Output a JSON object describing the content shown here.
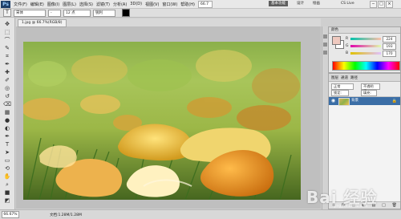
{
  "app": {
    "logo_text": "Ps",
    "menu": [
      "文件(F)",
      "编辑(E)",
      "图像(I)",
      "图层(L)",
      "选择(S)",
      "滤镜(T)",
      "分析(A)",
      "3D(D)",
      "视图(V)",
      "窗口(W)",
      "帮助(H)"
    ],
    "zoom_field": "66.7",
    "workspace_active": "基本功能",
    "workspace_links": [
      "设计",
      "绘画"
    ],
    "cs_live": "CS Live"
  },
  "options": {
    "font_family": "宋体",
    "font_style": "-",
    "font_size": "12 点",
    "anti_alias": "锐利",
    "color_hex": "#000000"
  },
  "document": {
    "tab_label": "1.jpg @ 66.7%(RGB/8)"
  },
  "tools": [
    {
      "name": "move-tool-icon",
      "symbol": "✥"
    },
    {
      "name": "marquee-tool-icon",
      "symbol": "⬚"
    },
    {
      "name": "lasso-tool-icon",
      "symbol": "⌒"
    },
    {
      "name": "quick-select-tool-icon",
      "symbol": "✎"
    },
    {
      "name": "crop-tool-icon",
      "symbol": "⌗"
    },
    {
      "name": "eyedropper-tool-icon",
      "symbol": "✒"
    },
    {
      "name": "healing-brush-tool-icon",
      "symbol": "✚"
    },
    {
      "name": "brush-tool-icon",
      "symbol": "✐"
    },
    {
      "name": "clone-stamp-tool-icon",
      "symbol": "◎"
    },
    {
      "name": "history-brush-tool-icon",
      "symbol": "↺"
    },
    {
      "name": "eraser-tool-icon",
      "symbol": "⌫"
    },
    {
      "name": "gradient-tool-icon",
      "symbol": "▦"
    },
    {
      "name": "blur-tool-icon",
      "symbol": "●"
    },
    {
      "name": "dodge-tool-icon",
      "symbol": "◐"
    },
    {
      "name": "pen-tool-icon",
      "symbol": "✒"
    },
    {
      "name": "type-tool-icon",
      "symbol": "T"
    },
    {
      "name": "path-select-tool-icon",
      "symbol": "➤"
    },
    {
      "name": "shape-tool-icon",
      "symbol": "▭"
    },
    {
      "name": "3d-rotate-tool-icon",
      "symbol": "⟲"
    },
    {
      "name": "hand-tool-icon",
      "symbol": "✋"
    },
    {
      "name": "zoom-tool-icon",
      "symbol": "⌕"
    },
    {
      "name": "foreground-background-icon",
      "symbol": "■"
    },
    {
      "name": "quick-mask-icon",
      "symbol": "◩"
    }
  ],
  "color_panel": {
    "title": "颜色",
    "r_label": "R",
    "g_label": "G",
    "b_label": "B",
    "r_value": "224",
    "g_value": "193",
    "b_value": "170"
  },
  "layers": {
    "tabs": [
      "图层",
      "通道",
      "路径"
    ],
    "blend_mode": "正常",
    "opacity_label": "不透明度:",
    "fill_label": "填充:",
    "lock_label": "锁定:",
    "layer_name": "背景"
  },
  "status": {
    "zoom": "66.67%",
    "doc_info": "文档:1.28M/1.28M"
  },
  "watermark": {
    "text": "Bai 经验",
    "sub": "jingyan.baidu.com"
  }
}
